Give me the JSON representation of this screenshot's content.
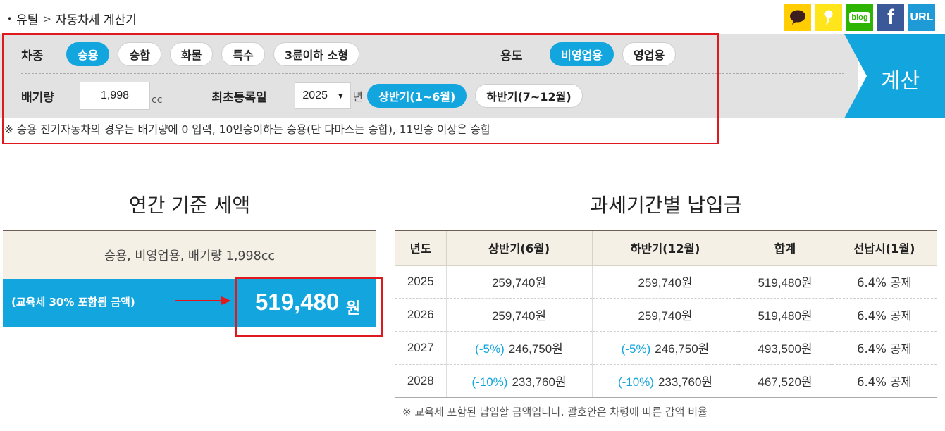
{
  "breadcrumb": {
    "bullet": "•",
    "parent": "유틸",
    "separator": ">",
    "current": "자동차세 계산기"
  },
  "share": {
    "icons": [
      "kakaotalk-icon",
      "kakaostory-icon",
      "blog-icon",
      "facebook-icon",
      "url-icon"
    ],
    "blog_label": "blog",
    "facebook_glyph": "f",
    "url_label": "URL"
  },
  "form": {
    "vehicle_type_label": "차종",
    "vehicle_types": [
      "승용",
      "승합",
      "화물",
      "특수",
      "3륜이하 소형"
    ],
    "vehicle_type_selected": "승용",
    "usage_label": "용도",
    "usages": [
      "비영업용",
      "영업용"
    ],
    "usage_selected": "비영업용",
    "displacement_label": "배기량",
    "displacement_value": "1,998",
    "displacement_unit": "cc",
    "reg_date_label": "최초등록일",
    "reg_year": "2025",
    "reg_year_suffix": "년",
    "halves": [
      "상반기(1~6월)",
      "하반기(7~12월)"
    ],
    "half_selected": "상반기(1~6월)",
    "calc_button": "계산",
    "note": "※ 승용 전기자동차의 경우는 배기량에 0 입력, 10인승이하는 승용(단 다마스는 승합), 11인승 이상은 승합"
  },
  "annual": {
    "title": "연간 기준 세액",
    "summary": "승용, 비영업용, 배기량 1,998cc",
    "amount_label": "(교육세 30% 포함됨 금액)",
    "amount": "519,480",
    "amount_unit": "원"
  },
  "payments": {
    "title": "과세기간별 납입금",
    "columns": [
      "년도",
      "상반기(6월)",
      "하반기(12월)",
      "합계",
      "선납시(1월)"
    ],
    "rows": [
      {
        "year": "2025",
        "first_disc": "",
        "first": "259,740원",
        "second_disc": "",
        "second": "259,740원",
        "total": "519,480원",
        "prepay": "6.4% 공제"
      },
      {
        "year": "2026",
        "first_disc": "",
        "first": "259,740원",
        "second_disc": "",
        "second": "259,740원",
        "total": "519,480원",
        "prepay": "6.4% 공제"
      },
      {
        "year": "2027",
        "first_disc": "(-5%)",
        "first": "246,750원",
        "second_disc": "(-5%)",
        "second": "246,750원",
        "total": "493,500원",
        "prepay": "6.4% 공제"
      },
      {
        "year": "2028",
        "first_disc": "(-10%)",
        "first": "233,760원",
        "second_disc": "(-10%)",
        "second": "233,760원",
        "total": "467,520원",
        "prepay": "6.4% 공제"
      }
    ],
    "note": "※ 교육세 포함된 납입할 금액입니다. 괄호안은 차령에 따른 감액 비율"
  },
  "colors": {
    "accent": "#13a6de",
    "panel": "#e2e2e2",
    "highlight_border": "#e0191e",
    "table_header": "#f5f0e6"
  }
}
